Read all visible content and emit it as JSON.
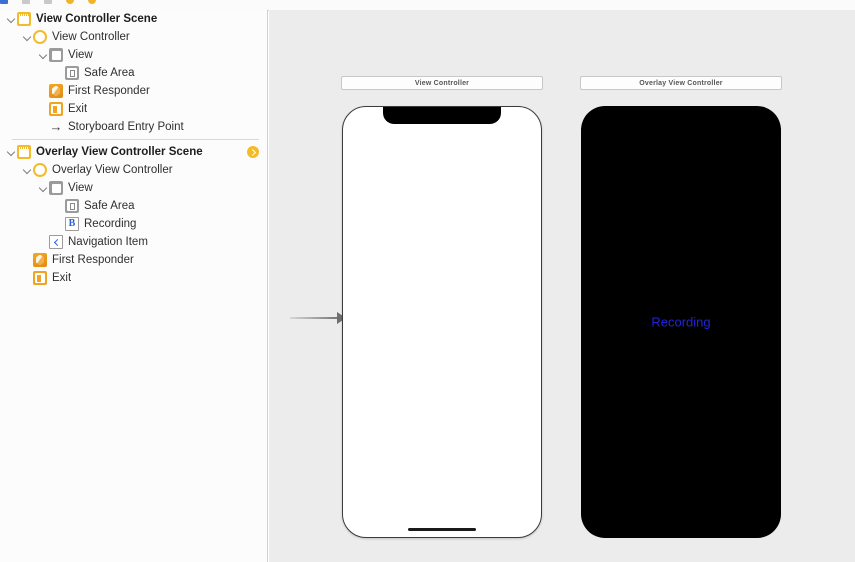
{
  "breadcrumb": {
    "items": [
      {
        "icon": "project-icon",
        "label": "",
        "kind": "blue"
      },
      {
        "icon": "folder-icon",
        "label": "",
        "kind": "gray"
      },
      {
        "icon": "file-icon",
        "label": "",
        "kind": "gray"
      },
      {
        "icon": "scene-icon",
        "label": "",
        "kind": "yellow"
      },
      {
        "icon": "scene-icon",
        "label": "",
        "kind": "yellow"
      }
    ]
  },
  "outline": {
    "groups": [
      {
        "rows": [
          {
            "label": "View Controller Scene",
            "icon": "storyboard-scene-icon",
            "indent": 0,
            "twisty": true,
            "style": "scene",
            "name": "outline-row-view-controller-scene",
            "badge": false
          },
          {
            "label": "View Controller",
            "icon": "view-controller-icon",
            "indent": 1,
            "twisty": true,
            "style": "item",
            "name": "outline-row-view-controller",
            "badge": false
          },
          {
            "label": "View",
            "icon": "view-icon",
            "indent": 2,
            "twisty": true,
            "style": "item",
            "name": "outline-row-view",
            "badge": false
          },
          {
            "label": "Safe Area",
            "icon": "safe-area-icon",
            "indent": 3,
            "twisty": false,
            "style": "item",
            "name": "outline-row-safe-area",
            "badge": false
          },
          {
            "label": "First Responder",
            "icon": "first-responder-icon",
            "indent": 2,
            "twisty": false,
            "style": "item",
            "name": "outline-row-first-responder",
            "badge": false
          },
          {
            "label": "Exit",
            "icon": "exit-icon",
            "indent": 2,
            "twisty": false,
            "style": "item",
            "name": "outline-row-exit",
            "badge": false
          },
          {
            "label": "Storyboard Entry Point",
            "icon": "entry-point-arrow-icon",
            "indent": 2,
            "twisty": false,
            "style": "item",
            "name": "outline-row-storyboard-entry-point",
            "badge": false
          }
        ]
      },
      {
        "rows": [
          {
            "label": "Overlay View Controller Scene",
            "icon": "storyboard-scene-icon",
            "indent": 0,
            "twisty": true,
            "style": "scene",
            "name": "outline-row-overlay-view-controller-scene",
            "badge": true
          },
          {
            "label": "Overlay View Controller",
            "icon": "view-controller-icon",
            "indent": 1,
            "twisty": true,
            "style": "item",
            "name": "outline-row-overlay-view-controller",
            "badge": false
          },
          {
            "label": "View",
            "icon": "view-icon",
            "indent": 2,
            "twisty": true,
            "style": "item",
            "name": "outline-row-overlay-view",
            "badge": false
          },
          {
            "label": "Safe Area",
            "icon": "safe-area-icon",
            "indent": 3,
            "twisty": false,
            "style": "item",
            "name": "outline-row-overlay-safe-area",
            "badge": false
          },
          {
            "label": "Recording",
            "icon": "button-icon",
            "indent": 3,
            "twisty": false,
            "style": "item",
            "name": "outline-row-recording-button",
            "badge": false
          },
          {
            "label": "Navigation Item",
            "icon": "navigation-item-icon",
            "indent": 2,
            "twisty": false,
            "style": "item",
            "name": "outline-row-navigation-item",
            "badge": false
          },
          {
            "label": "First Responder",
            "icon": "first-responder-icon",
            "indent": 1,
            "twisty": false,
            "style": "item",
            "name": "outline-row-overlay-first-responder",
            "badge": false
          },
          {
            "label": "Exit",
            "icon": "exit-icon",
            "indent": 1,
            "twisty": false,
            "style": "item",
            "name": "outline-row-overlay-exit",
            "badge": false
          }
        ]
      }
    ]
  },
  "canvas": {
    "background_color": "#ececec",
    "scenes": [
      {
        "title": "View Controller",
        "device_style": "light",
        "has_notch": true,
        "has_home_indicator": true,
        "screen_color": "#ffffff",
        "content_label": ""
      },
      {
        "title": "Overlay View Controller",
        "device_style": "dark",
        "has_notch": false,
        "has_home_indicator": false,
        "screen_color": "#000000",
        "content_label": "Recording"
      }
    ],
    "entry_point_arrow": "segue-entry-arrow"
  },
  "colors": {
    "accent_yellow": "#f3bb2c",
    "accent_orange": "#f0a41f",
    "link_blue": "#2222dd",
    "button_blue": "#2d5fd4"
  }
}
